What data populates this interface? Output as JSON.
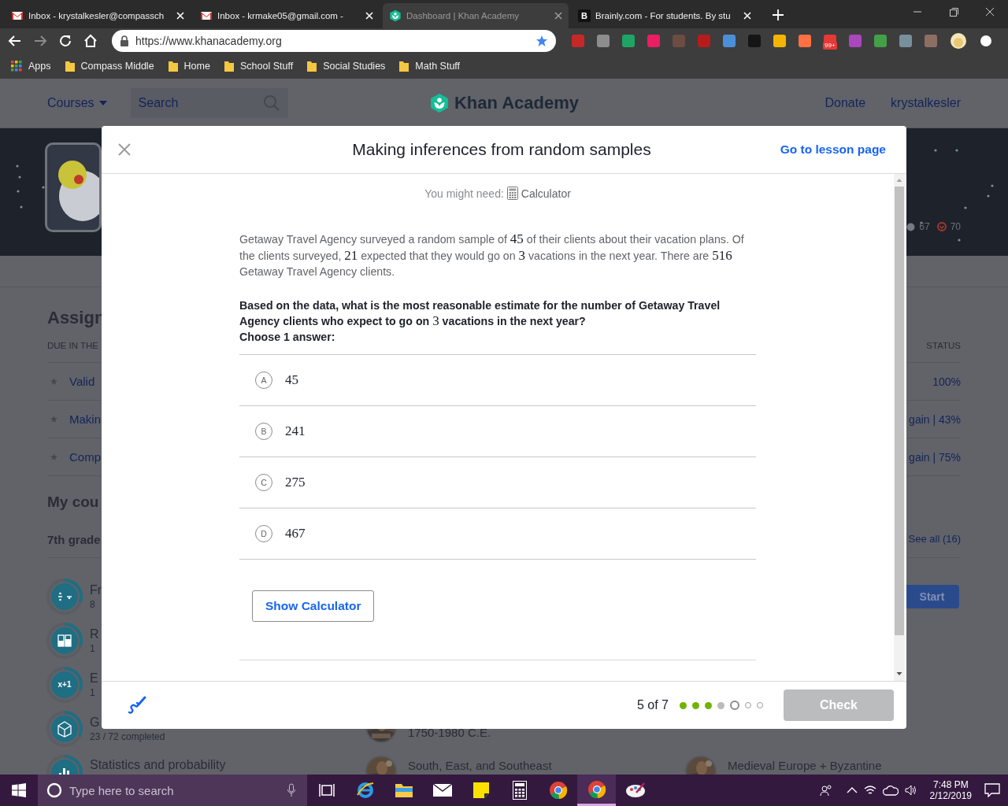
{
  "browser": {
    "tabs": [
      {
        "kind": "gmail",
        "title": "Inbox - krystalkesler@compassch",
        "selected": false
      },
      {
        "kind": "gmail",
        "title": "Inbox - krmake05@gmail.com -",
        "selected": false
      },
      {
        "kind": "khan",
        "title": "Dashboard | Khan Academy",
        "selected": true
      },
      {
        "kind": "brainly",
        "icon_text": "B",
        "title": "Brainly.com - For students. By stu",
        "selected": false
      }
    ],
    "url": "https://www.khanacademy.org",
    "extension_badge": "99+",
    "bookmarks": [
      {
        "kind": "apps",
        "label": "Apps"
      },
      {
        "kind": "folder",
        "label": "Compass Middle"
      },
      {
        "kind": "folder",
        "label": "Home"
      },
      {
        "kind": "folder",
        "label": "School Stuff"
      },
      {
        "kind": "folder",
        "label": "Social Studies"
      },
      {
        "kind": "folder",
        "label": "Math Stuff"
      }
    ]
  },
  "site_header": {
    "courses": "Courses",
    "search_placeholder": "Search",
    "logo": "Khan Academy",
    "donate": "Donate",
    "user": "krystalkesler"
  },
  "profile": {
    "points": "67",
    "streak": "70"
  },
  "assignments": {
    "title": "Assign",
    "due_header": "DUE IN THE",
    "status_header": "STATUS",
    "rows": [
      {
        "title": "Valid",
        "status": "100%"
      },
      {
        "title": "Makin",
        "status": "gain | 43%"
      },
      {
        "title": "Comp",
        "status": "gain | 75%"
      }
    ]
  },
  "courses": {
    "title": "My cou",
    "grade": "7th grade",
    "see_all": "See all (16)",
    "start": "Start",
    "items": [
      {
        "kind": "fraction",
        "title": "Fr",
        "subtitle": "8",
        "level": 0.3
      },
      {
        "kind": "ratio",
        "title": "R",
        "subtitle": "1",
        "level": 0.3
      },
      {
        "kind": "expression",
        "icon_label": "x+1",
        "title": "E",
        "subtitle": "1",
        "level": 0.3
      },
      {
        "kind": "geometry",
        "title": "G",
        "subtitle": "23 / 72 completed",
        "level": 0.32
      },
      {
        "kind": "statistics",
        "title": "Statistics and probability",
        "level": 0.3
      }
    ]
  },
  "unit_rows": [
    [
      {
        "subtitle": "1750-1980 C.E."
      }
    ],
    [
      {
        "title": "South, East, and Southeast"
      },
      {
        "title": "Medieval Europe + Byzantine"
      }
    ]
  ],
  "modal": {
    "title": "Making inferences from random samples",
    "lesson_link": "Go to lesson page",
    "tool_hint": "You might need:",
    "tool": "Calculator",
    "passage": [
      {
        "kind": "text",
        "text": "Getaway Travel Agency surveyed a random sample of "
      },
      {
        "kind": "math",
        "text": "45"
      },
      {
        "kind": "text",
        "text": " of their clients about their vacation plans. Of the clients surveyed, "
      },
      {
        "kind": "math",
        "text": "21"
      },
      {
        "kind": "text",
        "text": " expected that they would go on "
      },
      {
        "kind": "math",
        "text": "3"
      },
      {
        "kind": "text",
        "text": " vacations in the next year. There are "
      },
      {
        "kind": "math",
        "text": "516"
      },
      {
        "kind": "text",
        "text": " Getaway Travel Agency clients."
      }
    ],
    "question": [
      {
        "kind": "text",
        "text": "Based on the data, what is the most reasonable estimate for the number of Getaway Travel Agency clients who expect to go on "
      },
      {
        "kind": "math",
        "text": "3"
      },
      {
        "kind": "text",
        "text": " vacations in the next year?"
      }
    ],
    "instruction": "Choose 1 answer:",
    "choices": [
      {
        "letter": "A",
        "value": "45",
        "selected": false
      },
      {
        "letter": "B",
        "value": "241",
        "selected": false
      },
      {
        "letter": "C",
        "value": "275",
        "selected": false
      },
      {
        "letter": "D",
        "value": "467",
        "selected": false
      }
    ],
    "show_calculator": "Show Calculator",
    "progress": "5 of 7",
    "steps": [
      {
        "kind": "done"
      },
      {
        "kind": "done"
      },
      {
        "kind": "done"
      },
      {
        "kind": "skipped"
      },
      {
        "kind": "current"
      },
      {
        "kind": "todo"
      },
      {
        "kind": "todo"
      }
    ],
    "check": {
      "label": "Check",
      "disabled": true
    }
  },
  "taskbar": {
    "search_placeholder": "Type here to search",
    "time": "7:48 PM",
    "date": "2/12/2019",
    "apps": [
      {
        "kind": "taskview",
        "active": false
      },
      {
        "kind": "ie",
        "active": false
      },
      {
        "kind": "explorer",
        "active": false
      },
      {
        "kind": "mail",
        "active": false
      },
      {
        "kind": "sticky",
        "active": false
      },
      {
        "kind": "calculator",
        "active": false
      },
      {
        "kind": "chrome",
        "active": false
      },
      {
        "kind": "chrome",
        "active": true
      },
      {
        "kind": "paint",
        "active": false
      }
    ]
  }
}
